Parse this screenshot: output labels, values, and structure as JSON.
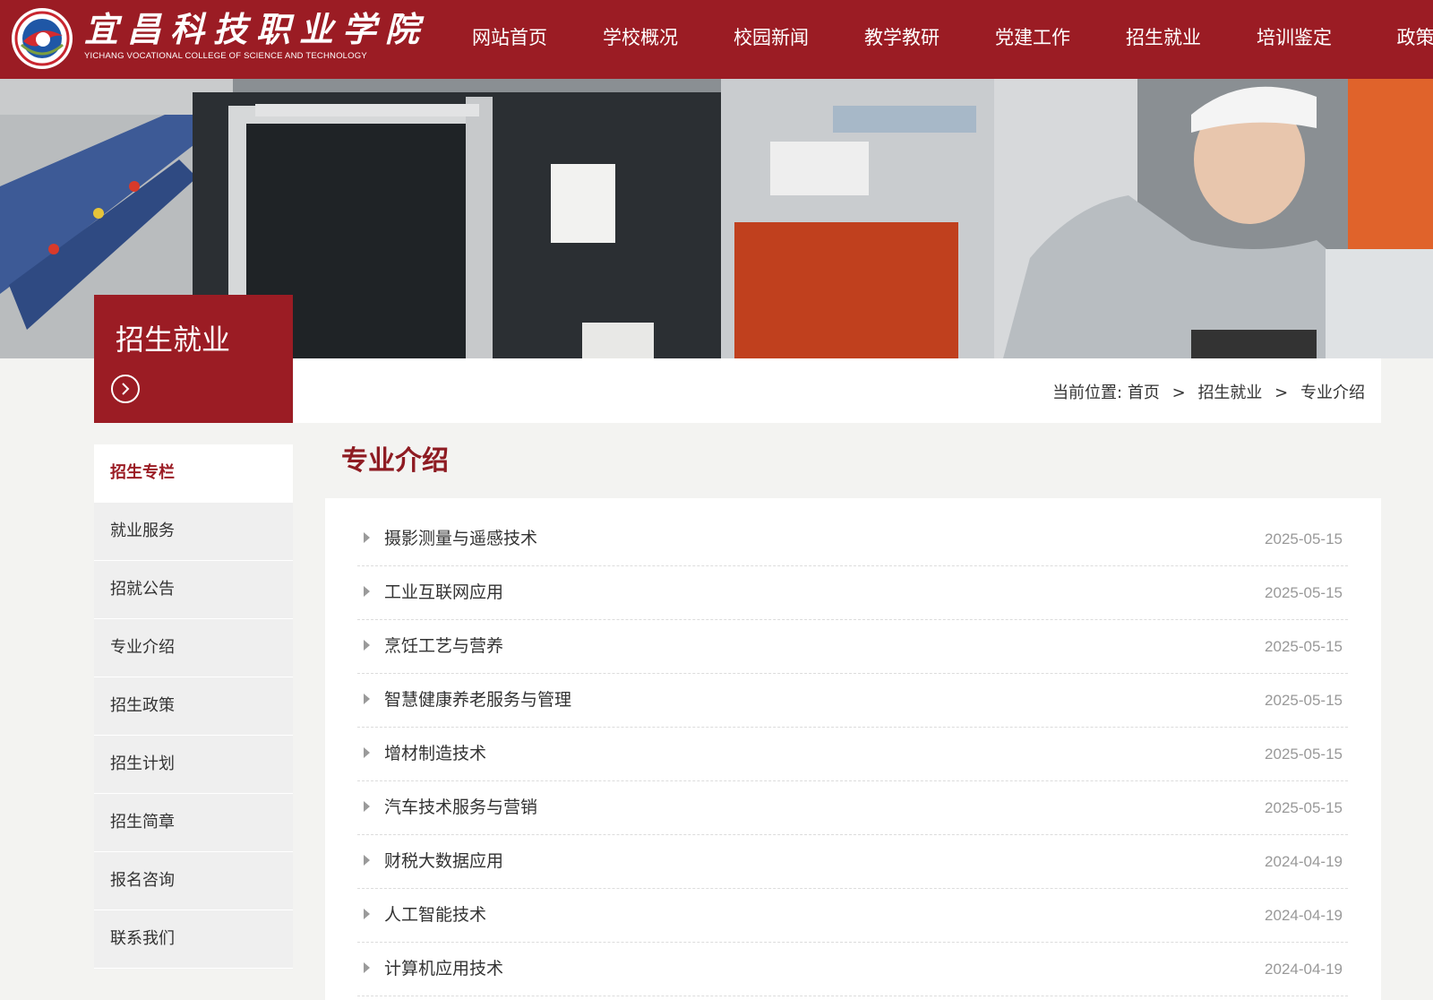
{
  "header": {
    "brand_name": "宜昌科技职业学院",
    "brand_en": "YICHANG VOCATIONAL COLLEGE OF SCIENCE AND TECHNOLOGY",
    "nav": [
      "网站首页",
      "学校概况",
      "校园新闻",
      "教学教研",
      "党建工作",
      "招生就业",
      "培训鉴定",
      "政策图"
    ]
  },
  "sidebar": {
    "title": "招生就业",
    "items": [
      {
        "label": "招生专栏",
        "active": true
      },
      {
        "label": "就业服务"
      },
      {
        "label": "招就公告"
      },
      {
        "label": "专业介绍"
      },
      {
        "label": "招生政策"
      },
      {
        "label": "招生计划"
      },
      {
        "label": "招生简章"
      },
      {
        "label": "报名咨询"
      },
      {
        "label": "联系我们"
      }
    ]
  },
  "breadcrumb": {
    "prefix": "当前位置:",
    "items": [
      "首页",
      "招生就业",
      "专业介绍"
    ],
    "separator": ">"
  },
  "main": {
    "title": "专业介绍",
    "articles": [
      {
        "title": "摄影测量与遥感技术",
        "date": "2025-05-15"
      },
      {
        "title": "工业互联网应用",
        "date": "2025-05-15"
      },
      {
        "title": "烹饪工艺与营养",
        "date": "2025-05-15"
      },
      {
        "title": "智慧健康养老服务与管理",
        "date": "2025-05-15"
      },
      {
        "title": "增材制造技术",
        "date": "2025-05-15"
      },
      {
        "title": "汽车技术服务与营销",
        "date": "2025-05-15"
      },
      {
        "title": "财税大数据应用",
        "date": "2024-04-19"
      },
      {
        "title": "人工智能技术",
        "date": "2024-04-19"
      },
      {
        "title": "计算机应用技术",
        "date": "2024-04-19"
      }
    ]
  },
  "colors": {
    "brand_red": "#9b1c24",
    "title_red": "#8e1b22",
    "date_gray": "#999999"
  },
  "icons": {
    "arrow": "chevron-right-circle-icon",
    "list_bullet": "triangle-right-icon"
  }
}
